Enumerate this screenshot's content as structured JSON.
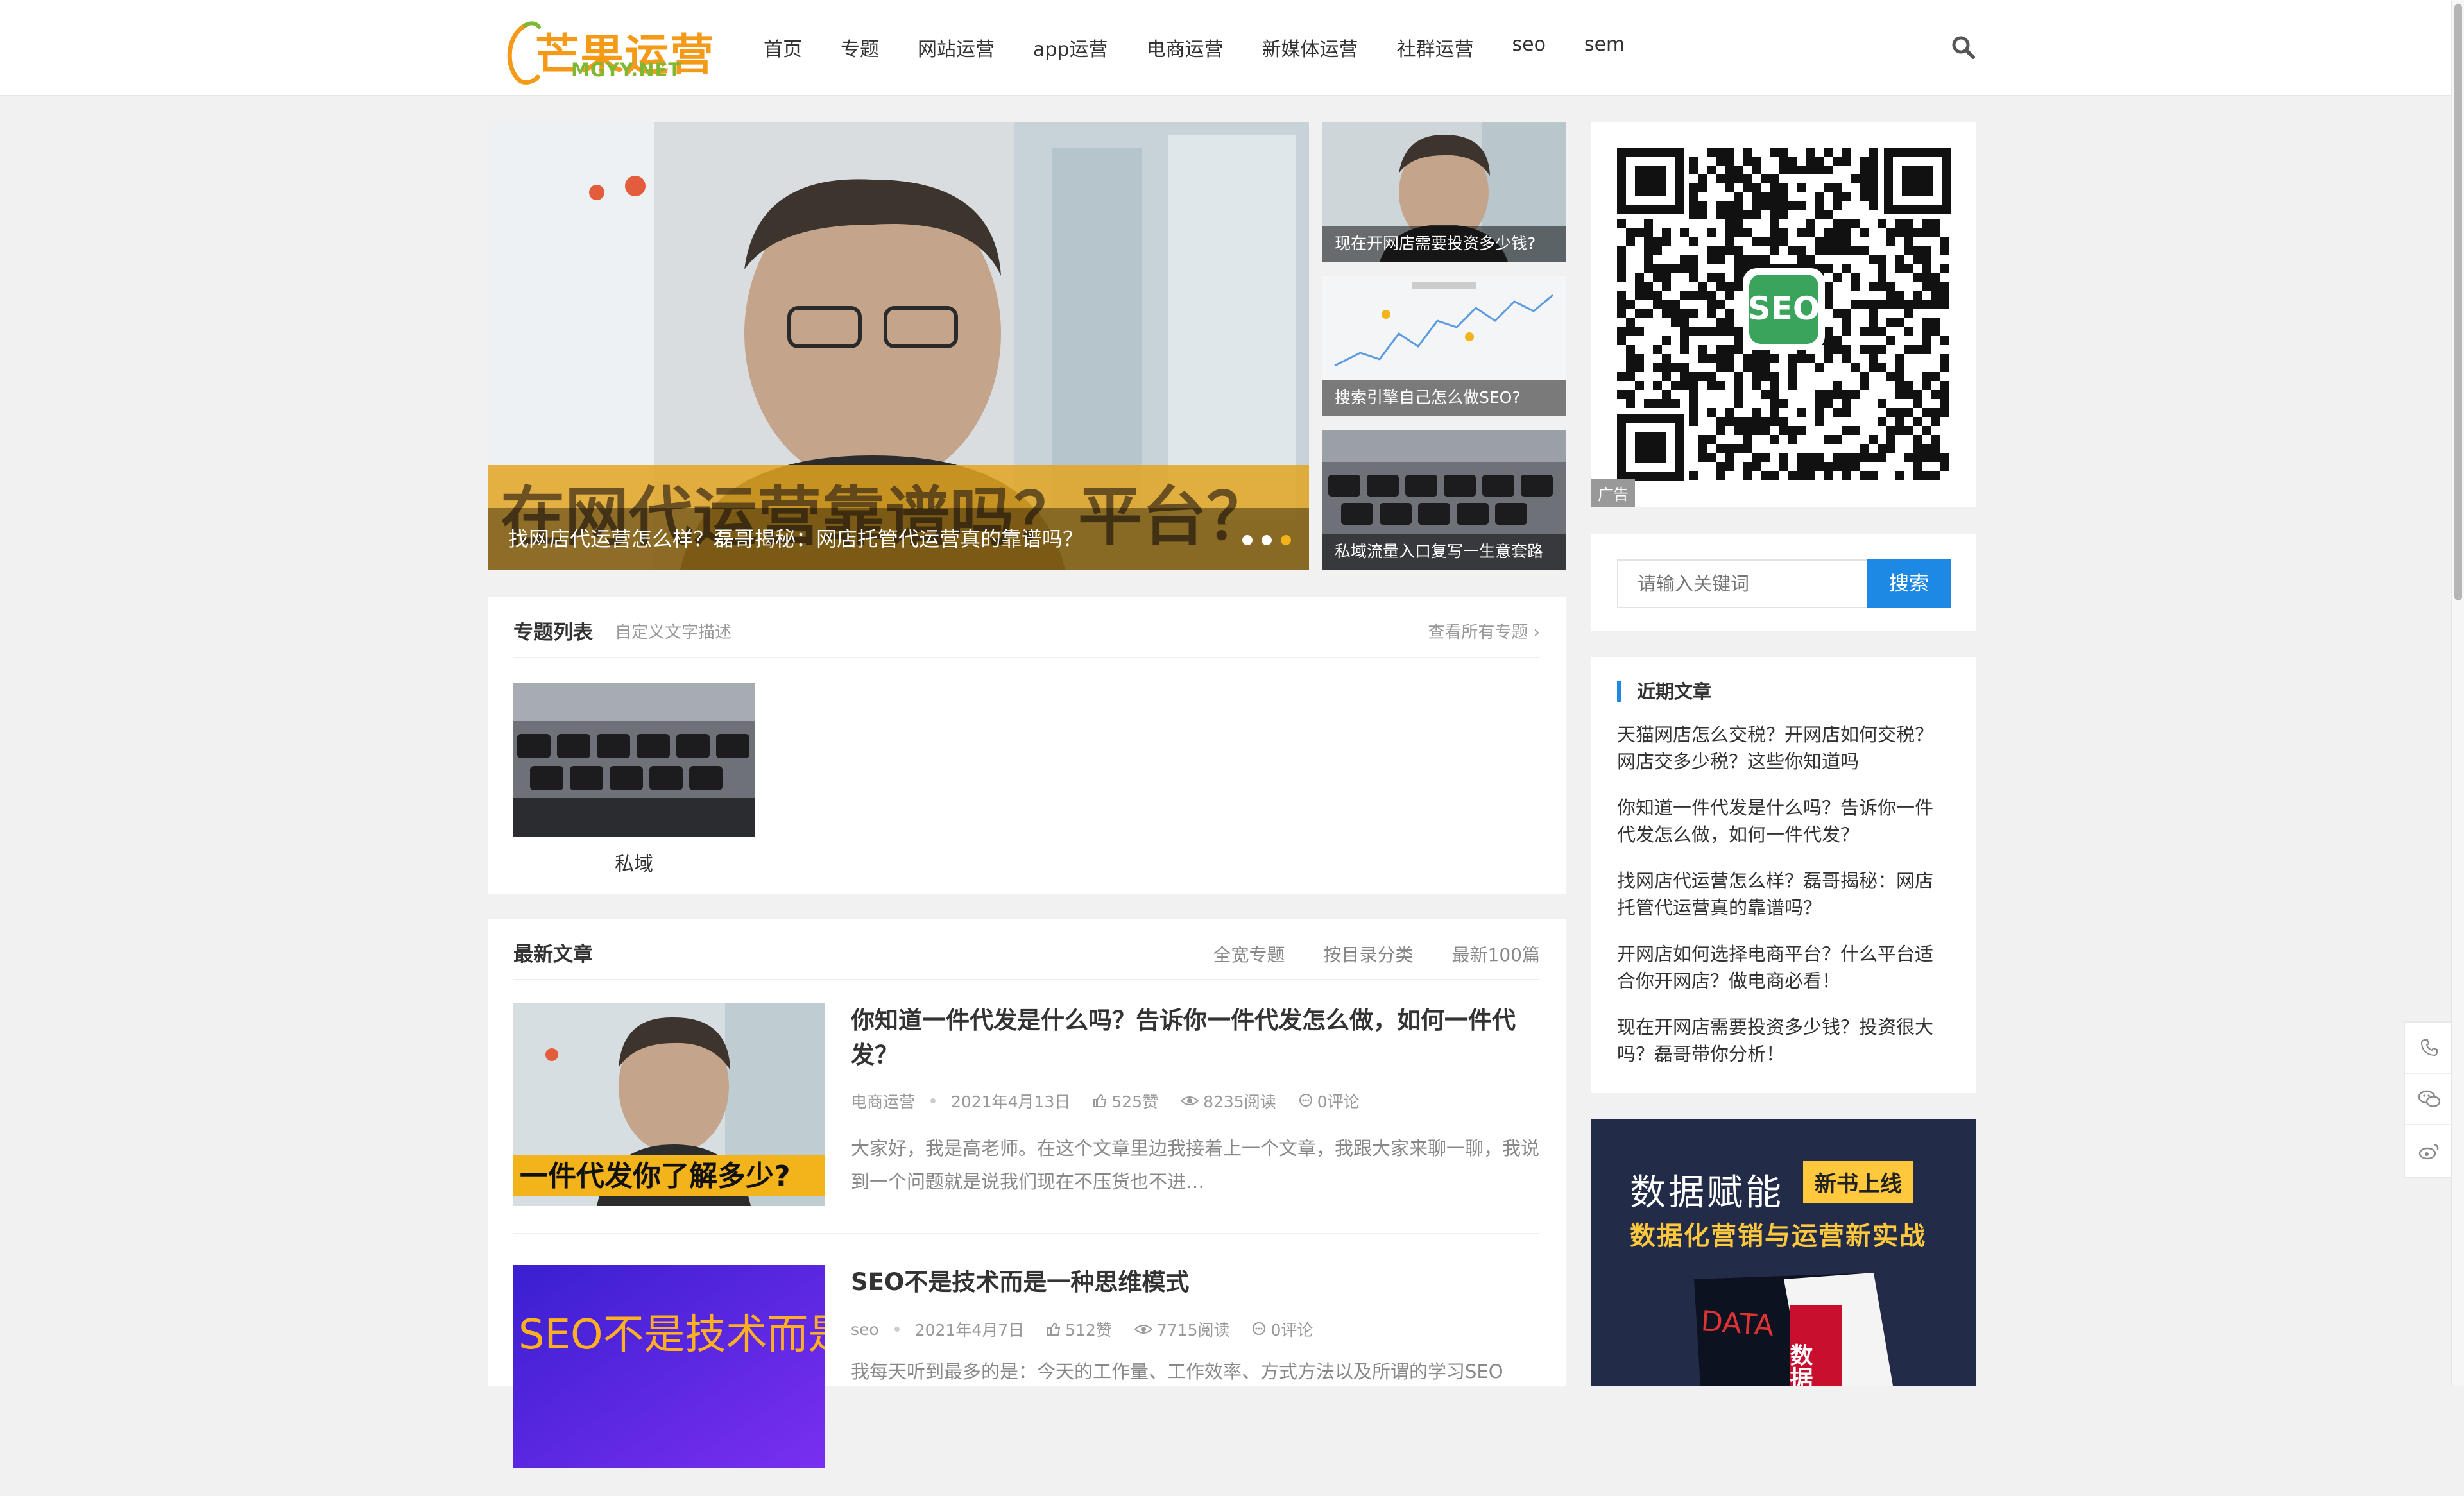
{
  "header": {
    "logo_text": "芒果运营",
    "logo_sub": "MGYY.NET",
    "nav": [
      "首页",
      "专题",
      "网站运营",
      "app运营",
      "电商运营",
      "新媒体运营",
      "社群运营",
      "seo",
      "sem"
    ]
  },
  "slider": {
    "main_caption": "找网店代运营怎么样？磊哥揭秘：网店托管代运营真的靠谱吗？",
    "main_overlay_text": "在网代运营靠谱吗？平台？",
    "thumbs": [
      {
        "caption": "现在开网店需要投资多少钱?"
      },
      {
        "caption": "搜索引擎自己怎么做SEO?"
      },
      {
        "caption": "私域流量入口复写一生意套路"
      }
    ]
  },
  "topics": {
    "title": "专题列表",
    "desc": "自定义文字描述",
    "more": "查看所有专题",
    "items": [
      {
        "name": "私域"
      }
    ]
  },
  "latest": {
    "title": "最新文章",
    "tabs": [
      "全宽专题",
      "按目录分类",
      "最新100篇"
    ],
    "articles": [
      {
        "title": "你知道一件代发是什么吗？告诉你一件代发怎么做，如何一件代发？",
        "category": "电商运营",
        "date": "2021年4月13日",
        "likes": "525赞",
        "views": "8235阅读",
        "comments": "0评论",
        "excerpt": "大家好，我是高老师。在这个文章里边我接着上一个文章，我跟大家来聊一聊，我说到一个问题就是说我们现在不压货也不进…",
        "image_text": "一件代发你了解多少?"
      },
      {
        "title": "SEO不是技术而是一种思维模式",
        "category": "seo",
        "date": "2021年4月7日",
        "likes": "512赞",
        "views": "7715阅读",
        "comments": "0评论",
        "excerpt": "我每天听到最多的是：今天的工作量、工作效率、方式方法以及所谓的学习SEO",
        "image_text": "SEO不是技术而是一种思维模式"
      }
    ]
  },
  "sidebar": {
    "qr_badge": "SEO",
    "ad_label": "广告",
    "search": {
      "placeholder": "请输入关键词",
      "button": "搜索"
    },
    "recent_title": "近期文章",
    "recent": [
      "天猫网店怎么交税？开网店如何交税？网店交多少税？这些你知道吗",
      "你知道一件代发是什么吗？告诉你一件代发怎么做，如何一件代发？",
      "找网店代运营怎么样？磊哥揭秘：网店托管代运营真的靠谱吗？",
      "开网店如何选择电商平台？什么平台适合你开网店？做电商必看！",
      "现在开网店需要投资多少钱？投资很大吗？磊哥带你分析！"
    ],
    "book_ad": {
      "title": "数据赋能",
      "badge": "新书上线",
      "sub": "数据化营销与运营新实战",
      "cover_text": "数据"
    }
  },
  "float_tools": [
    "phone-icon",
    "wechat-icon",
    "weibo-icon"
  ],
  "colors": {
    "accent": "#1e88e5",
    "logo_orange": "#f49a17",
    "logo_green": "#7fb832",
    "dot_active": "#f2b31b"
  }
}
